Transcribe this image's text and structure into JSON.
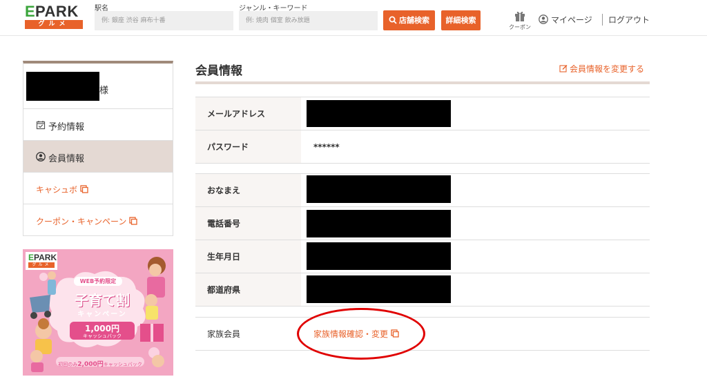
{
  "header": {
    "logo_main": "PARK",
    "logo_e": "E",
    "logo_sub": "グルメ",
    "station_label": "駅名",
    "station_placeholder": "例: 銀座 渋谷 麻布十番",
    "genre_label": "ジャンル・キーワード",
    "genre_placeholder": "例: 焼肉 個室 飲み放題",
    "search_button": "店舗検索",
    "detail_button": "詳細検索",
    "coupon_label": "クーポン",
    "mypage_label": "マイページ",
    "logout_label": "ログアウト"
  },
  "sidebar": {
    "user_suffix": "様",
    "items": [
      {
        "label": "予約情報"
      },
      {
        "label": "会員情報"
      }
    ],
    "links": [
      {
        "label": "キャシュボ"
      },
      {
        "label": "クーポン・キャンペーン"
      }
    ]
  },
  "banner": {
    "logo_main": "PARK",
    "logo_e": "E",
    "logo_sub": "グルメ",
    "tag": "WEB予約限定",
    "title": "子育て割",
    "subtitle": "キャンペーン",
    "amount": "1,000円",
    "amount_sub": "キャッシュバック",
    "first_prefix": "初回のみ",
    "first_amount": "2,000円",
    "first_suffix": "キャッシュバック"
  },
  "main": {
    "title": "会員情報",
    "edit_link": "会員情報を変更する",
    "group1": [
      {
        "label": "メールアドレス",
        "value": ""
      },
      {
        "label": "パスワード",
        "value": "******"
      }
    ],
    "group2": [
      {
        "label": "おなまえ"
      },
      {
        "label": "電話番号"
      },
      {
        "label": "生年月日"
      },
      {
        "label": "都道府県"
      }
    ],
    "family": {
      "label": "家族会員",
      "link": "家族情報確認・変更"
    }
  },
  "colors": {
    "accent": "#e8622a",
    "brand_green": "#3aa43a",
    "active_bg": "#e4d9d3",
    "annotation": "#e00000"
  }
}
